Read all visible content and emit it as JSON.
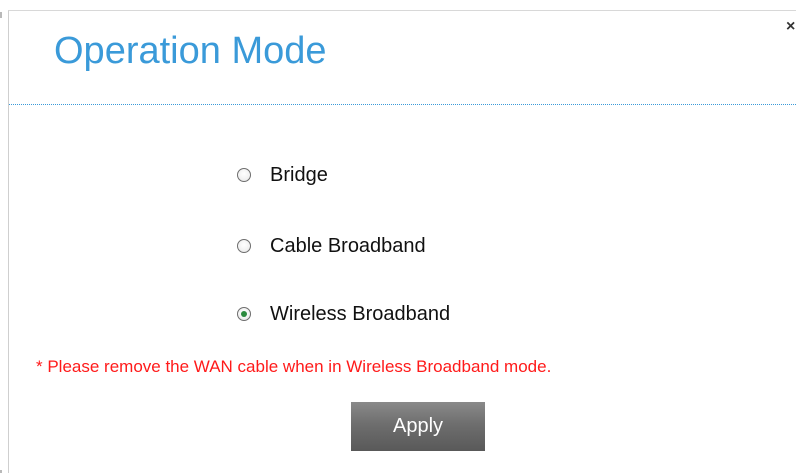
{
  "dialog": {
    "title": "Operation Mode",
    "close_label": "×",
    "options": [
      {
        "label": "Bridge",
        "checked": false
      },
      {
        "label": "Cable Broadband",
        "checked": false
      },
      {
        "label": "Wireless Broadband",
        "checked": true
      }
    ],
    "warning": "* Please remove the WAN cable when in Wireless Broadband mode.",
    "apply_label": "Apply"
  },
  "colors": {
    "title": "#3a9ad9",
    "warning": "#ff1a1a",
    "button": "#6e6e6e",
    "radio_dot": "#2b8a3e"
  }
}
